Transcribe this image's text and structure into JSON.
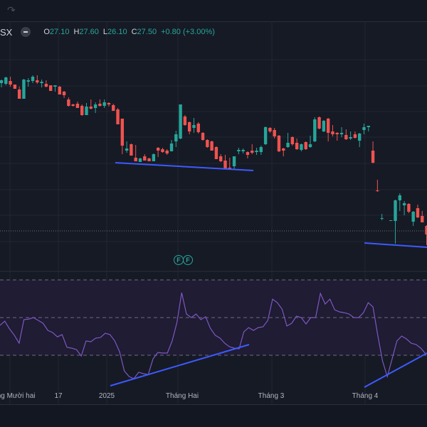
{
  "toolbar": {
    "redo_icon": "redo-arrow-icon"
  },
  "legend": {
    "symbol": "SX",
    "open_label": "O",
    "open": "27.10",
    "high_label": "H",
    "high": "27.60",
    "low_label": "L",
    "low": "26.10",
    "close_label": "C",
    "close": "27.50",
    "change": "+0.80 (+3.00%)"
  },
  "markers": [
    "F",
    "F"
  ],
  "time_axis": [
    "Tháng Mười hai",
    "17",
    "2025",
    "Tháng Hai",
    "Tháng 3",
    "Tháng 4"
  ],
  "colors": {
    "up": "#26a69a",
    "down": "#ef5350",
    "rsi_line": "#7e57c2",
    "trendline": "#3d5afe",
    "background": "#161a25"
  },
  "chart_data": [
    {
      "type": "candlestick",
      "ohlc": [
        [
          33.74,
          33.89,
          33.56,
          33.86
        ],
        [
          33.71,
          34.01,
          33.65,
          33.98
        ],
        [
          33.83,
          34.01,
          33.59,
          33.68
        ],
        [
          33.68,
          33.68,
          33.5,
          33.5
        ],
        [
          33.47,
          33.59,
          33.08,
          33.08
        ],
        [
          33.08,
          33.92,
          33.08,
          33.89
        ],
        [
          33.8,
          33.95,
          33.59,
          33.86
        ],
        [
          33.83,
          34.07,
          33.74,
          34.01
        ],
        [
          33.86,
          34.07,
          33.71,
          33.77
        ],
        [
          33.74,
          33.89,
          33.56,
          33.8
        ],
        [
          33.71,
          33.86,
          33.56,
          33.59
        ],
        [
          33.65,
          33.65,
          33.41,
          33.41
        ],
        [
          33.59,
          33.65,
          33.38,
          33.65
        ],
        [
          33.59,
          33.62,
          33.26,
          33.26
        ],
        [
          33.38,
          33.41,
          33.11,
          33.23
        ],
        [
          33.05,
          33.14,
          32.75,
          32.78
        ],
        [
          32.84,
          32.87,
          32.75,
          32.78
        ],
        [
          32.87,
          32.96,
          32.69,
          32.69
        ],
        [
          32.78,
          32.84,
          32.36,
          32.39
        ],
        [
          32.39,
          32.9,
          32.39,
          32.75
        ],
        [
          32.75,
          33.05,
          32.63,
          32.66
        ],
        [
          32.69,
          32.93,
          32.48,
          32.84
        ],
        [
          32.87,
          33.05,
          32.75,
          32.78
        ],
        [
          32.78,
          33.05,
          32.69,
          32.93
        ],
        [
          32.9,
          32.93,
          32.75,
          32.84
        ],
        [
          32.81,
          32.87,
          32.57,
          32.57
        ],
        [
          32.63,
          32.69,
          32.0,
          32.0
        ],
        [
          32.24,
          32.24,
          30.74,
          31.1
        ],
        [
          30.89,
          31.28,
          30.8,
          30.98
        ],
        [
          31.16,
          31.19,
          30.68,
          30.68
        ],
        [
          30.59,
          31.13,
          30.44,
          30.44
        ],
        [
          30.41,
          30.59,
          30.41,
          30.56
        ],
        [
          30.65,
          30.74,
          30.47,
          30.47
        ],
        [
          30.56,
          30.59,
          30.44,
          30.44
        ],
        [
          30.44,
          30.77,
          30.44,
          30.74
        ],
        [
          31.01,
          31.04,
          30.62,
          30.89
        ],
        [
          30.95,
          31.01,
          30.8,
          30.83
        ],
        [
          30.89,
          30.95,
          30.71,
          30.77
        ],
        [
          30.86,
          31.34,
          30.86,
          31.19
        ],
        [
          31.28,
          31.73,
          31.04,
          31.58
        ],
        [
          31.4,
          32.84,
          31.37,
          32.84
        ],
        [
          32.33,
          32.39,
          31.94,
          31.97
        ],
        [
          32.09,
          32.12,
          31.58,
          31.7
        ],
        [
          31.85,
          32.27,
          31.64,
          31.97
        ],
        [
          32.03,
          32.09,
          31.61,
          31.67
        ],
        [
          31.64,
          31.67,
          31.31,
          31.34
        ],
        [
          31.34,
          31.37,
          31.01,
          31.04
        ],
        [
          31.28,
          31.31,
          30.89,
          30.89
        ],
        [
          31.04,
          31.07,
          30.53,
          30.53
        ],
        [
          30.65,
          30.74,
          30.41,
          30.44
        ],
        [
          30.47,
          30.71,
          30.11,
          30.14
        ],
        [
          30.17,
          30.59,
          30.11,
          30.11
        ],
        [
          30.23,
          30.65,
          30.11,
          30.65
        ],
        [
          30.86,
          31.01,
          30.74,
          30.92
        ],
        [
          30.86,
          30.98,
          30.77,
          30.92
        ],
        [
          30.83,
          30.86,
          30.56,
          30.71
        ],
        [
          30.89,
          31.16,
          30.74,
          30.8
        ],
        [
          30.83,
          31.01,
          30.71,
          30.89
        ],
        [
          30.83,
          31.1,
          30.71,
          31.04
        ],
        [
          31.16,
          31.91,
          31.13,
          31.88
        ],
        [
          31.85,
          31.88,
          31.64,
          31.7
        ],
        [
          31.76,
          31.85,
          31.4,
          31.49
        ],
        [
          31.52,
          31.55,
          30.83,
          30.86
        ],
        [
          30.98,
          31.01,
          30.65,
          30.89
        ],
        [
          31.04,
          31.64,
          31.01,
          31.22
        ],
        [
          31.46,
          31.49,
          31.1,
          31.16
        ],
        [
          31.22,
          31.4,
          30.92,
          30.95
        ],
        [
          30.92,
          31.19,
          30.86,
          31.16
        ],
        [
          31.25,
          31.28,
          30.92,
          30.95
        ],
        [
          31.04,
          31.52,
          31.01,
          31.16
        ],
        [
          31.28,
          32.3,
          31.25,
          32.21
        ],
        [
          32.3,
          32.33,
          31.79,
          31.82
        ],
        [
          31.7,
          32.18,
          31.67,
          32.15
        ],
        [
          32.24,
          32.27,
          31.28,
          31.64
        ],
        [
          31.7,
          31.97,
          31.49,
          31.58
        ],
        [
          31.64,
          31.67,
          31.31,
          31.58
        ],
        [
          31.58,
          31.88,
          31.46,
          31.64
        ],
        [
          31.55,
          31.79,
          31.34,
          31.37
        ],
        [
          31.4,
          31.7,
          31.34,
          31.46
        ],
        [
          31.58,
          31.7,
          31.4,
          31.43
        ],
        [
          31.31,
          31.64,
          31.04,
          31.61
        ],
        [
          31.76,
          32.03,
          31.58,
          31.88
        ],
        [
          31.88,
          31.94,
          31.7,
          31.94
        ],
        [
          30.89,
          31.28,
          30.35,
          30.38
        ],
        [
          29.21,
          29.66,
          29.15,
          29.18
        ],
        [
          28.01,
          28.22,
          27.95,
          28.04
        ],
        null,
        [
          27.92,
          27.95,
          27.92,
          27.95
        ],
        [
          27.92,
          28.82,
          26.96,
          28.79
        ],
        [
          28.79,
          29.09,
          28.34,
          29.0
        ],
        [
          28.58,
          28.76,
          28.16,
          28.67
        ],
        [
          28.64,
          28.67,
          28.25,
          28.31
        ],
        [
          27.89,
          28.34,
          27.71,
          28.31
        ],
        [
          28.46,
          28.61,
          28.04,
          28.07
        ],
        [
          28.13,
          28.34,
          27.86,
          27.86
        ],
        [
          27.71,
          27.74,
          26.9,
          27.35
        ]
      ],
      "price_line": 27.5
    },
    {
      "type": "line",
      "indicator": "RSI",
      "levels": [
        70,
        50,
        30
      ],
      "values": [
        45.9,
        48.1,
        44.0,
        40.6,
        36.4,
        48.9,
        49.2,
        50.0,
        48.5,
        47.0,
        43.2,
        42.1,
        39.8,
        41.0,
        34.2,
        33.8,
        33.0,
        29.6,
        37.6,
        37.2,
        39.1,
        39.4,
        41.7,
        41.0,
        37.6,
        31.9,
        21.7,
        18.7,
        17.6,
        21.0,
        20.2,
        19.8,
        28.1,
        31.5,
        31.2,
        31.2,
        37.6,
        47.4,
        63.2,
        51.9,
        50.0,
        51.9,
        48.9,
        50.4,
        44.3,
        40.6,
        39.1,
        36.4,
        34.5,
        33.8,
        33.4,
        42.5,
        44.7,
        43.2,
        44.7,
        45.1,
        48.5,
        59.8,
        57.9,
        54.5,
        45.5,
        47.0,
        50.8,
        50.0,
        46.6,
        50.0,
        50.0,
        62.8,
        57.2,
        59.8,
        54.1,
        53.0,
        52.6,
        51.9,
        50.0,
        50.0,
        52.6,
        57.9,
        55.7,
        40.6,
        27.0,
        18.7,
        28.1,
        37.6,
        40.2,
        38.7,
        36.4,
        35.7,
        33.8,
        30.8
      ]
    }
  ]
}
